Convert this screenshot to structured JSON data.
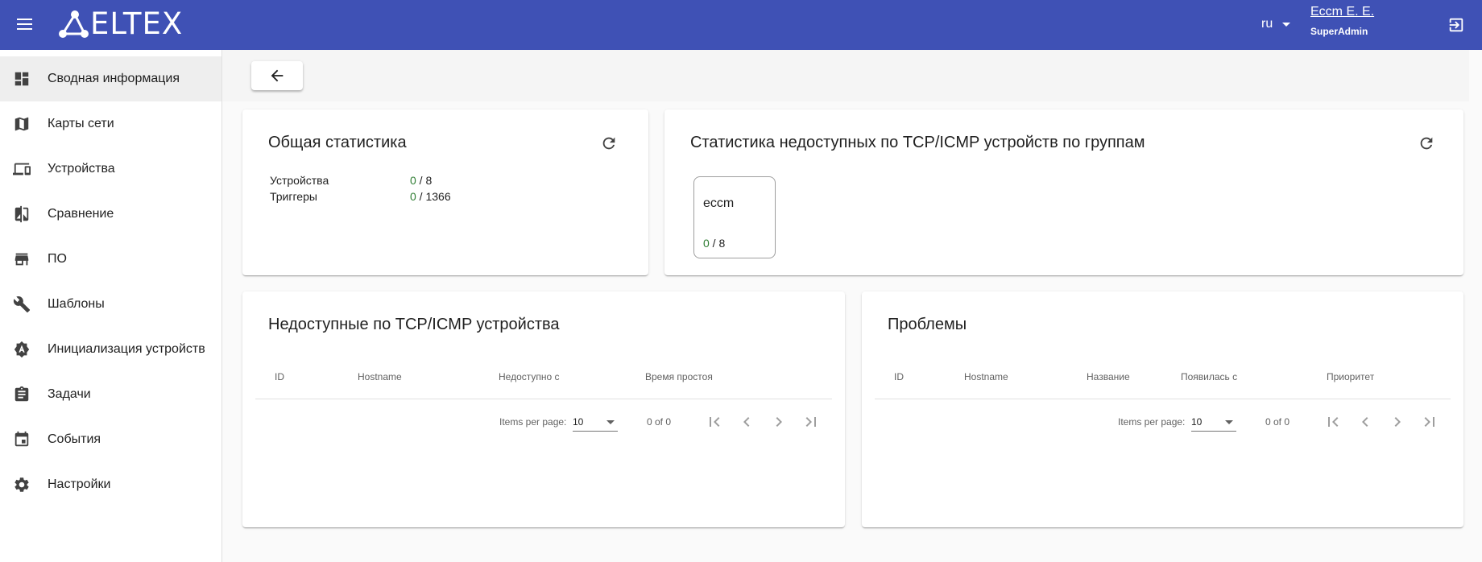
{
  "app": {
    "logo_text": "ELTEX",
    "language": "ru",
    "user_name": "Eccm E. E.",
    "user_role": "SuperAdmin"
  },
  "sidebar": {
    "items": [
      {
        "label": "Сводная информация",
        "icon": "dashboard-icon",
        "active": true
      },
      {
        "label": "Карты сети",
        "icon": "map-icon"
      },
      {
        "label": "Устройства",
        "icon": "devices-icon"
      },
      {
        "label": "Сравнение",
        "icon": "compare-icon"
      },
      {
        "label": "ПО",
        "icon": "store-icon"
      },
      {
        "label": "Шаблоны",
        "icon": "wrench-icon"
      },
      {
        "label": "Инициализация устройств",
        "icon": "initialization-icon"
      },
      {
        "label": "Задачи",
        "icon": "assignment-icon"
      },
      {
        "label": "События",
        "icon": "event-icon"
      },
      {
        "label": "Настройки",
        "icon": "gear-icon"
      }
    ]
  },
  "general_stats": {
    "title": "Общая статистика",
    "rows": [
      {
        "label": "Устройства",
        "value": "0",
        "total": " / 8"
      },
      {
        "label": "Триггеры",
        "value": "0",
        "total": " / 1366"
      }
    ]
  },
  "group_stats": {
    "title": "Статистика недоступных по TCP/ICMP устройств по группам",
    "groups": [
      {
        "name": "eccm",
        "value": "0",
        "total": " / 8"
      }
    ]
  },
  "unavailable": {
    "title": "Недоступные по TCP/ICMP устройства",
    "columns": [
      "ID",
      "Hostname",
      "Недоступно с",
      "Время простоя"
    ],
    "pager": {
      "items_per_page_label": "Items per page:",
      "page_size": "10",
      "range": "0 of 0"
    }
  },
  "problems": {
    "title": "Проблемы",
    "columns": [
      "ID",
      "Hostname",
      "Название",
      "Появилась с",
      "Приоритет"
    ],
    "pager": {
      "items_per_page_label": "Items per page:",
      "page_size": "10",
      "range": "0 of 0"
    }
  },
  "colors": {
    "primary": "#3f51b5",
    "ok_value": "#2e7d32"
  }
}
